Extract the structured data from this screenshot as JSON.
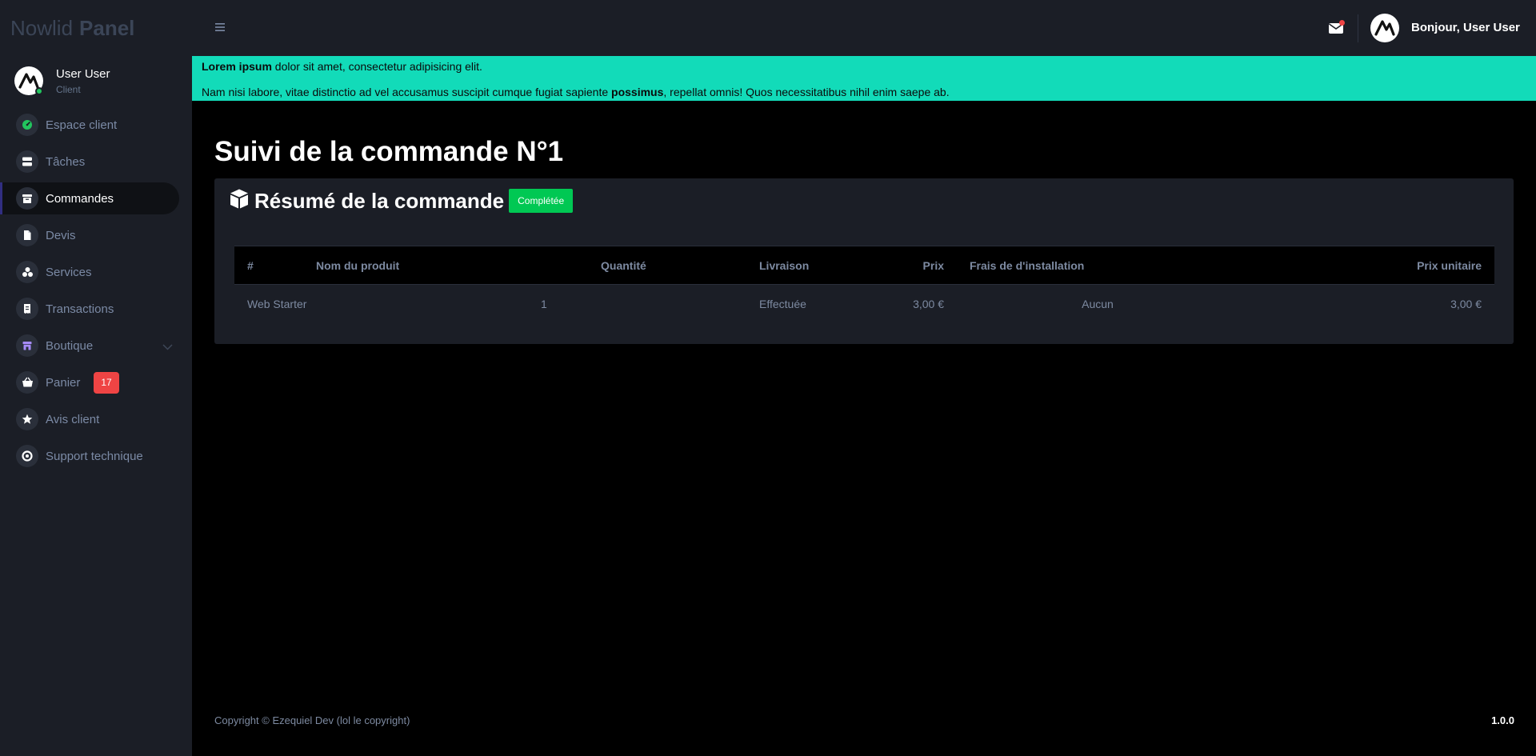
{
  "brand": {
    "part1": "Nowlid",
    "part2": "Panel"
  },
  "user": {
    "name": "User User",
    "role": "Client"
  },
  "sidebar": {
    "items": [
      {
        "label": "Espace client",
        "icon": "gauge-icon"
      },
      {
        "label": "Tâches",
        "icon": "server-icon"
      },
      {
        "label": "Commandes",
        "icon": "box-icon",
        "active": true
      },
      {
        "label": "Devis",
        "icon": "file-icon"
      },
      {
        "label": "Services",
        "icon": "cubes-icon"
      },
      {
        "label": "Transactions",
        "icon": "receipt-icon"
      },
      {
        "label": "Boutique",
        "icon": "store-icon"
      },
      {
        "label": "Panier",
        "icon": "basket-icon",
        "badge": "17"
      },
      {
        "label": "Avis client",
        "icon": "star-icon"
      },
      {
        "label": "Support technique",
        "icon": "lifebuoy-icon"
      }
    ]
  },
  "topbar": {
    "greeting": "Bonjour, User User"
  },
  "banner": {
    "line1_bold": "Lorem ipsum",
    "line1_rest": " dolor sit amet, consectetur adipisicing elit.",
    "line2_start": "Nam nisi labore, vitae distinctio ad vel accusamus suscipit cumque fugiat sapiente ",
    "line2_bold": "possimus",
    "line2_end": ", repellat omnis! Quos necessitatibus nihil enim saepe ab."
  },
  "page": {
    "title": "Suivi de la commande N°1"
  },
  "summary": {
    "title": "Résumé de la commande",
    "status": "Complétée",
    "columns": [
      "#",
      "Nom du produit",
      "Quantité",
      "Livraison",
      "Prix",
      "Frais de d'installation",
      "Prix unitaire"
    ],
    "rows": [
      {
        "name": "Web Starter",
        "quantity": "1",
        "delivery": "Effectuée",
        "price": "3,00 €",
        "setup": "Aucun",
        "unit_price": "3,00 €"
      }
    ]
  },
  "footer": {
    "copyright": "Copyright © Ezequiel Dev (lol le copyright)",
    "version": "1.0.0"
  },
  "colors": {
    "accent_banner": "#12dbb9",
    "status_green": "#00c853",
    "badge_red": "#ef4444",
    "sidebar_bg": "#1b1e26"
  }
}
